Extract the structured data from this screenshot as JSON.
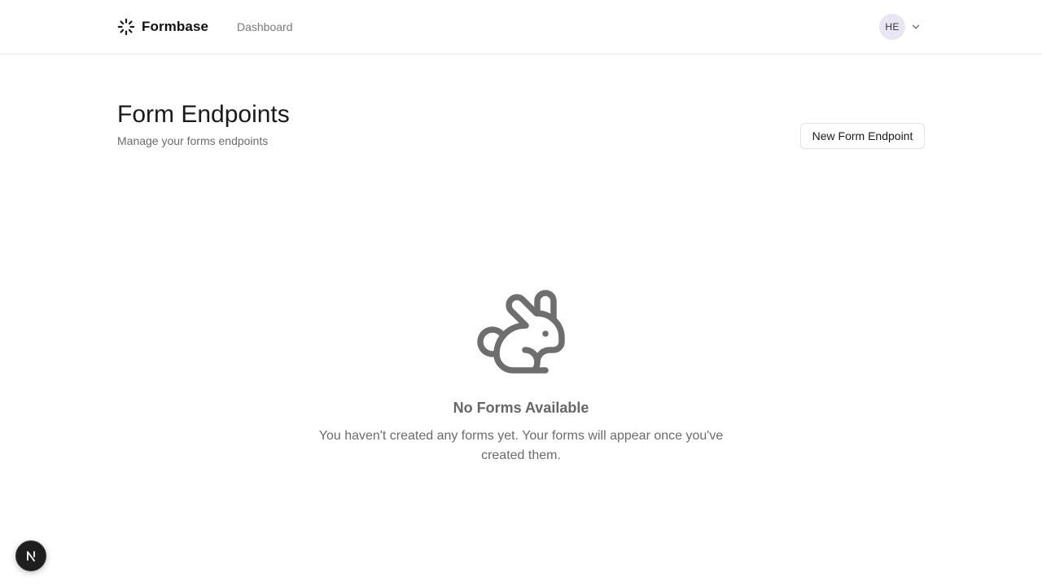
{
  "header": {
    "brand_name": "Formbase",
    "brand_icon": "loader-icon",
    "nav": [
      {
        "label": "Dashboard"
      }
    ],
    "user": {
      "initials": "HE",
      "menu_icon": "chevron-down-icon"
    }
  },
  "main": {
    "title": "Form Endpoints",
    "subtitle": "Manage your forms endpoints",
    "new_button_label": "New Form Endpoint"
  },
  "empty_state": {
    "icon": "rabbit-icon",
    "title": "No Forms Available",
    "message": "You haven't created any forms yet. Your forms will appear once you've created them."
  },
  "dev_badge": {
    "label": "N"
  },
  "colors": {
    "border": "#e5e5e5",
    "avatar_bg": "#e9e5f3",
    "muted_text": "#6b6b6b",
    "nav_text": "#7a7a7a",
    "empty_icon": "#6e6e6e",
    "badge_bg": "#1e1e1e"
  }
}
